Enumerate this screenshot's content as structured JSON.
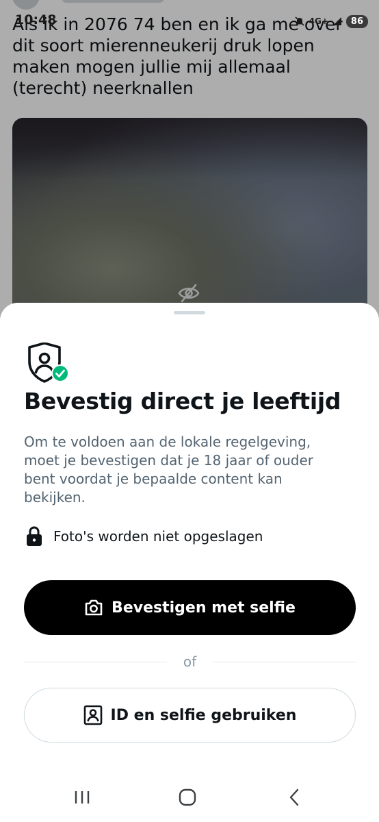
{
  "status_bar": {
    "time": "10:48",
    "network": "4G+",
    "battery": "86"
  },
  "tweet": {
    "text": "Als ik in 2076 74 ben en ik ga me over dit soort mierenneukerij druk lopen maken mogen jullie mij allemaal (terecht) neerknallen",
    "media_icon": "eye-slash-icon"
  },
  "sheet": {
    "title": "Bevestig direct je leeftijd",
    "description": "Om te voldoen aan de lokale regelgeving, moet je bevestigen dat je 18 jaar of ouder bent voordat je bepaalde content kan bekijken.",
    "privacy_note": "Foto's worden niet opgeslagen",
    "primary_button": "Bevestigen met selfie",
    "separator": "of",
    "secondary_button": "ID en selfie gebruiken",
    "accent_color": "#00ba7c"
  },
  "nav": {
    "recents_icon": "recents-icon",
    "home_icon": "home-icon",
    "back_icon": "back-icon"
  }
}
